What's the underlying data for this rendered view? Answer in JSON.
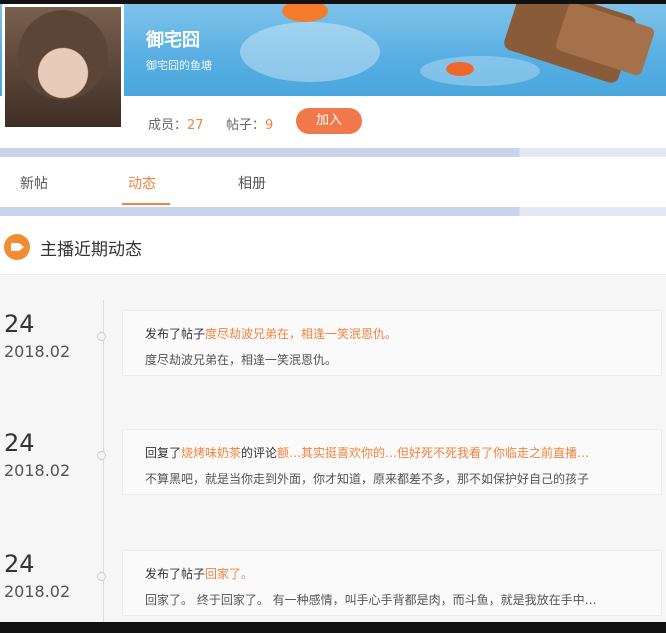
{
  "group": {
    "name": "御宅囧",
    "subtitle": "御宅囧的鱼塘",
    "members_label": "成员：",
    "members_count": "27",
    "posts_label": "帖子：",
    "posts_count": "9",
    "join_label": "加入"
  },
  "tabs": [
    {
      "label": "新帖"
    },
    {
      "label": "动态"
    },
    {
      "label": "相册"
    }
  ],
  "section": {
    "title": "主播近期动态",
    "icon": "video-camera-icon"
  },
  "feed": [
    {
      "day": "24",
      "year_month": "2018.02",
      "action": "发布了帖子",
      "link": "度尽劫波兄弟在，相逢一笑泯恩仇。",
      "comment_text": "",
      "snippet": "度尽劫波兄弟在，相逢一笑泯恩仇。"
    },
    {
      "day": "24",
      "year_month": "2018.02",
      "action": "回复了",
      "link": "烧烤味奶茶",
      "comment_prefix": "的评论",
      "comment_text": "额…其实挺喜欢你的…但好死不死我看了你临走之前直播…",
      "snippet": "不算黑吧，就是当你走到外面，你才知道，原来都差不多，那不如保护好自己的孩子"
    },
    {
      "day": "24",
      "year_month": "2018.02",
      "action": "发布了帖子",
      "link": "回家了。",
      "comment_text": "",
      "snippet": "回家了。 终于回家了。 有一种感情，叫手心手背都是肉，而斗鱼，就是我放在手中…"
    }
  ],
  "colors": {
    "accent": "#f08440",
    "banner_blue": "#57aee2",
    "join_button": "#f0784a"
  }
}
